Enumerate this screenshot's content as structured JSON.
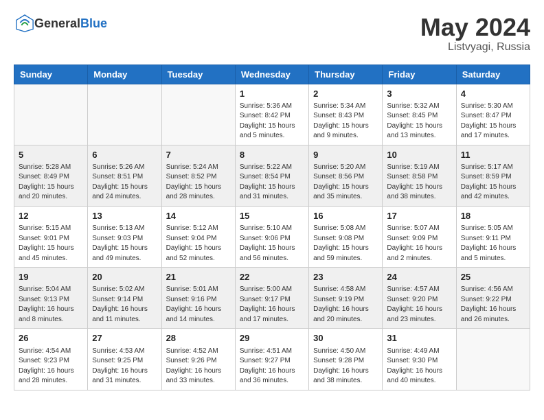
{
  "header": {
    "logo_general": "General",
    "logo_blue": "Blue",
    "month": "May 2024",
    "location": "Listvyagi, Russia"
  },
  "columns": [
    "Sunday",
    "Monday",
    "Tuesday",
    "Wednesday",
    "Thursday",
    "Friday",
    "Saturday"
  ],
  "rows": [
    [
      {
        "day": "",
        "info": ""
      },
      {
        "day": "",
        "info": ""
      },
      {
        "day": "",
        "info": ""
      },
      {
        "day": "1",
        "info": "Sunrise: 5:36 AM\nSunset: 8:42 PM\nDaylight: 15 hours\nand 5 minutes."
      },
      {
        "day": "2",
        "info": "Sunrise: 5:34 AM\nSunset: 8:43 PM\nDaylight: 15 hours\nand 9 minutes."
      },
      {
        "day": "3",
        "info": "Sunrise: 5:32 AM\nSunset: 8:45 PM\nDaylight: 15 hours\nand 13 minutes."
      },
      {
        "day": "4",
        "info": "Sunrise: 5:30 AM\nSunset: 8:47 PM\nDaylight: 15 hours\nand 17 minutes."
      }
    ],
    [
      {
        "day": "5",
        "info": "Sunrise: 5:28 AM\nSunset: 8:49 PM\nDaylight: 15 hours\nand 20 minutes."
      },
      {
        "day": "6",
        "info": "Sunrise: 5:26 AM\nSunset: 8:51 PM\nDaylight: 15 hours\nand 24 minutes."
      },
      {
        "day": "7",
        "info": "Sunrise: 5:24 AM\nSunset: 8:52 PM\nDaylight: 15 hours\nand 28 minutes."
      },
      {
        "day": "8",
        "info": "Sunrise: 5:22 AM\nSunset: 8:54 PM\nDaylight: 15 hours\nand 31 minutes."
      },
      {
        "day": "9",
        "info": "Sunrise: 5:20 AM\nSunset: 8:56 PM\nDaylight: 15 hours\nand 35 minutes."
      },
      {
        "day": "10",
        "info": "Sunrise: 5:19 AM\nSunset: 8:58 PM\nDaylight: 15 hours\nand 38 minutes."
      },
      {
        "day": "11",
        "info": "Sunrise: 5:17 AM\nSunset: 8:59 PM\nDaylight: 15 hours\nand 42 minutes."
      }
    ],
    [
      {
        "day": "12",
        "info": "Sunrise: 5:15 AM\nSunset: 9:01 PM\nDaylight: 15 hours\nand 45 minutes."
      },
      {
        "day": "13",
        "info": "Sunrise: 5:13 AM\nSunset: 9:03 PM\nDaylight: 15 hours\nand 49 minutes."
      },
      {
        "day": "14",
        "info": "Sunrise: 5:12 AM\nSunset: 9:04 PM\nDaylight: 15 hours\nand 52 minutes."
      },
      {
        "day": "15",
        "info": "Sunrise: 5:10 AM\nSunset: 9:06 PM\nDaylight: 15 hours\nand 56 minutes."
      },
      {
        "day": "16",
        "info": "Sunrise: 5:08 AM\nSunset: 9:08 PM\nDaylight: 15 hours\nand 59 minutes."
      },
      {
        "day": "17",
        "info": "Sunrise: 5:07 AM\nSunset: 9:09 PM\nDaylight: 16 hours\nand 2 minutes."
      },
      {
        "day": "18",
        "info": "Sunrise: 5:05 AM\nSunset: 9:11 PM\nDaylight: 16 hours\nand 5 minutes."
      }
    ],
    [
      {
        "day": "19",
        "info": "Sunrise: 5:04 AM\nSunset: 9:13 PM\nDaylight: 16 hours\nand 8 minutes."
      },
      {
        "day": "20",
        "info": "Sunrise: 5:02 AM\nSunset: 9:14 PM\nDaylight: 16 hours\nand 11 minutes."
      },
      {
        "day": "21",
        "info": "Sunrise: 5:01 AM\nSunset: 9:16 PM\nDaylight: 16 hours\nand 14 minutes."
      },
      {
        "day": "22",
        "info": "Sunrise: 5:00 AM\nSunset: 9:17 PM\nDaylight: 16 hours\nand 17 minutes."
      },
      {
        "day": "23",
        "info": "Sunrise: 4:58 AM\nSunset: 9:19 PM\nDaylight: 16 hours\nand 20 minutes."
      },
      {
        "day": "24",
        "info": "Sunrise: 4:57 AM\nSunset: 9:20 PM\nDaylight: 16 hours\nand 23 minutes."
      },
      {
        "day": "25",
        "info": "Sunrise: 4:56 AM\nSunset: 9:22 PM\nDaylight: 16 hours\nand 26 minutes."
      }
    ],
    [
      {
        "day": "26",
        "info": "Sunrise: 4:54 AM\nSunset: 9:23 PM\nDaylight: 16 hours\nand 28 minutes."
      },
      {
        "day": "27",
        "info": "Sunrise: 4:53 AM\nSunset: 9:25 PM\nDaylight: 16 hours\nand 31 minutes."
      },
      {
        "day": "28",
        "info": "Sunrise: 4:52 AM\nSunset: 9:26 PM\nDaylight: 16 hours\nand 33 minutes."
      },
      {
        "day": "29",
        "info": "Sunrise: 4:51 AM\nSunset: 9:27 PM\nDaylight: 16 hours\nand 36 minutes."
      },
      {
        "day": "30",
        "info": "Sunrise: 4:50 AM\nSunset: 9:28 PM\nDaylight: 16 hours\nand 38 minutes."
      },
      {
        "day": "31",
        "info": "Sunrise: 4:49 AM\nSunset: 9:30 PM\nDaylight: 16 hours\nand 40 minutes."
      },
      {
        "day": "",
        "info": ""
      }
    ]
  ]
}
